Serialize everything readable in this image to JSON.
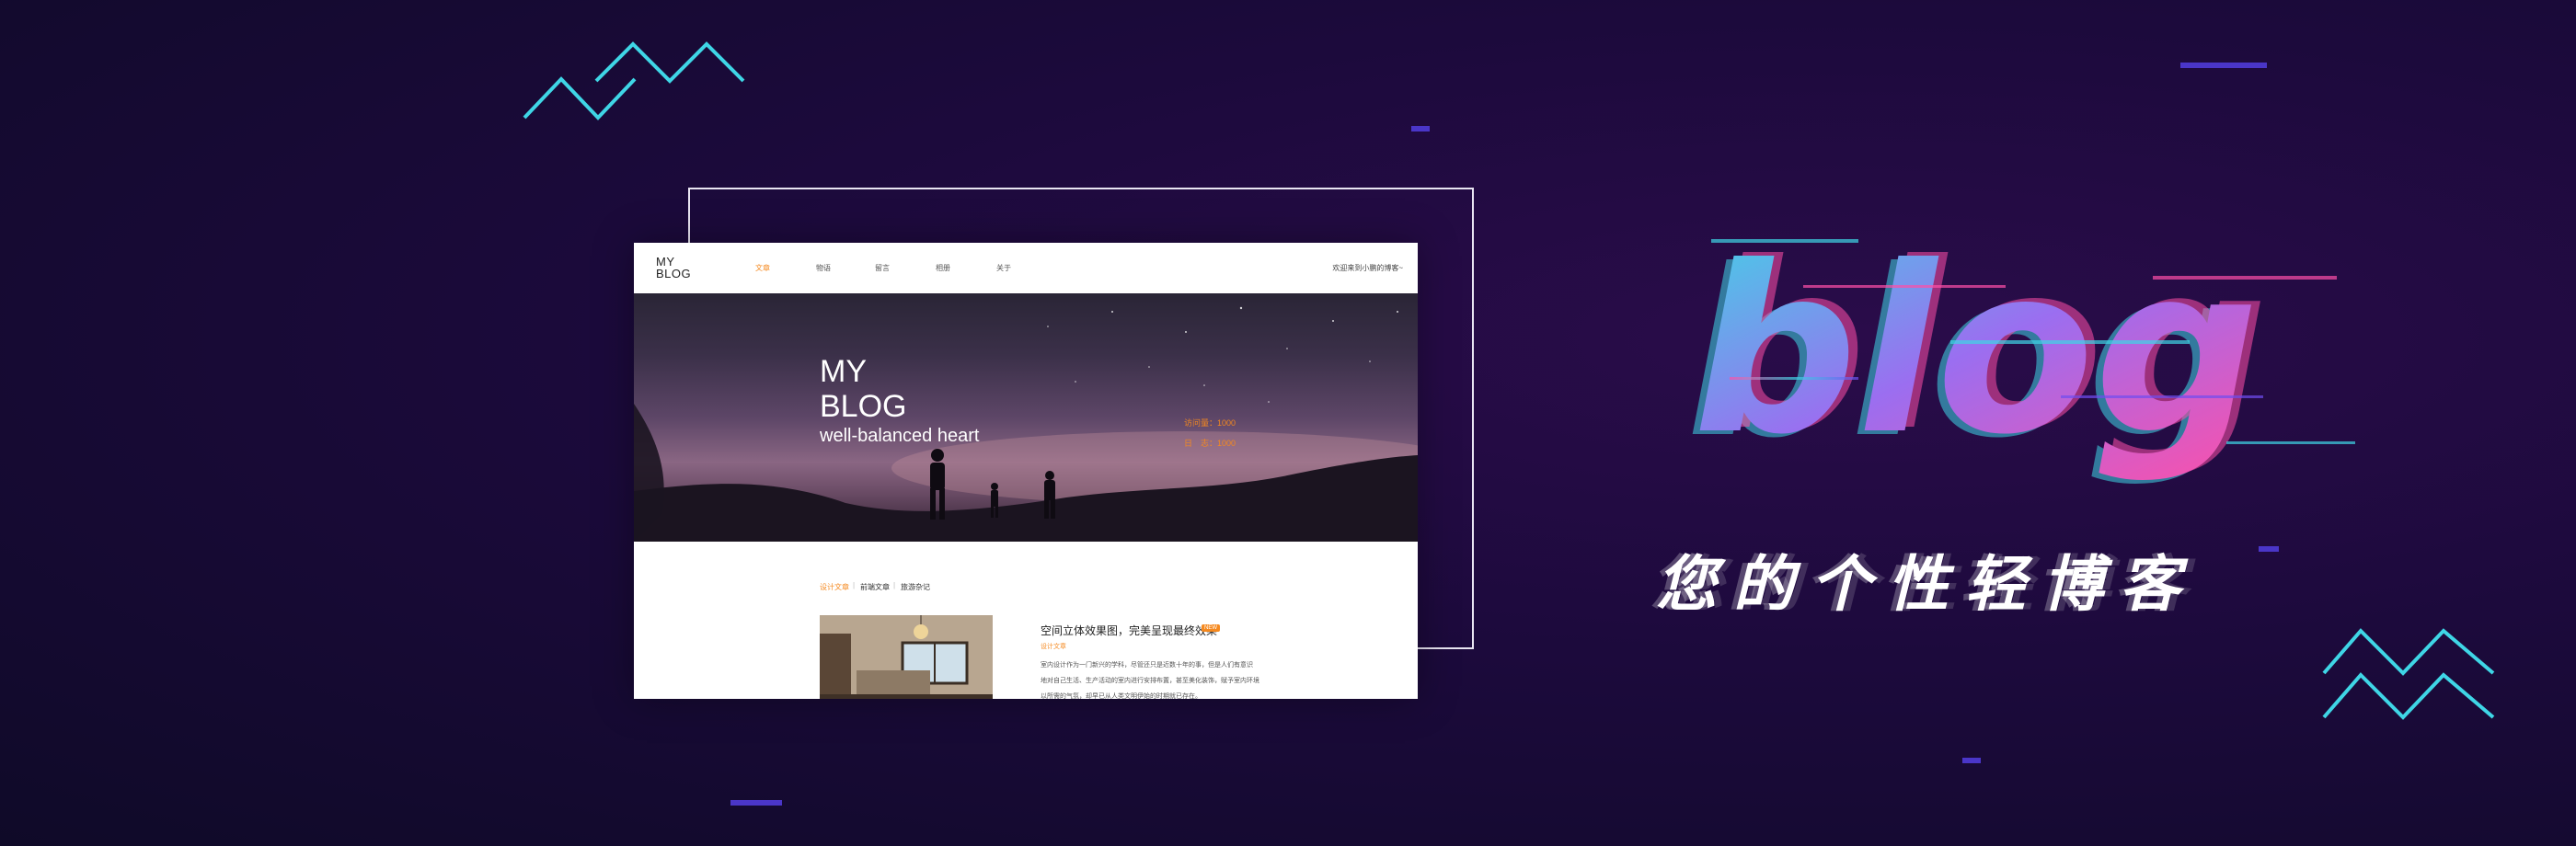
{
  "mockup": {
    "nav": {
      "logo_line1": "MY",
      "logo_line2": "BLOG",
      "items": [
        "文章",
        "物语",
        "留言",
        "相册",
        "关于"
      ],
      "active_index": 0,
      "welcome": "欢迎来到小鹏的博客~"
    },
    "hero": {
      "title_line1": "MY",
      "title_line2": "BLOG",
      "subtitle": "well-balanced heart",
      "stats": [
        "访问量：1000",
        "日　志：1000"
      ]
    },
    "tabs": [
      "设计文章",
      "前端文章",
      "旅游杂记"
    ],
    "article": {
      "title": "空间立体效果图，完美呈现最终效果",
      "badge": "NEW",
      "category": "设计文章",
      "lines": [
        "室内设计作为一门新兴的学科，尽管还只是近数十年的事，但是人们有意识",
        "地对自己生活、生产活动的室内进行安排布置，甚至美化装饰，赋予室内环境",
        "以所需的气氛，却早已从人类文明伊始的时期就已存在。"
      ]
    }
  },
  "headline": {
    "word": "blog",
    "subtitle": "您的个性轻博客"
  },
  "colors": {
    "background": "#1c0a3c",
    "accent_cyan": "#3fd6e6",
    "accent_pink": "#ff4fa8",
    "accent_purple": "#6f4df0",
    "accent_orange": "#f5891f",
    "dash": "#4a36c8"
  }
}
